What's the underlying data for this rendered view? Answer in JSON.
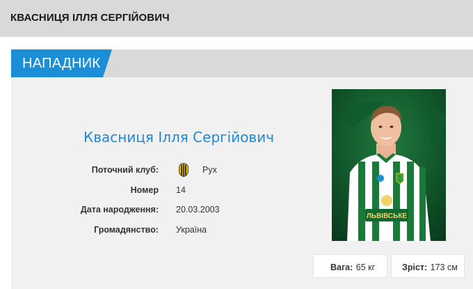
{
  "page": {
    "title": "КВАСНИЦЯ ІЛЛЯ СЕРГІЙОВИЧ"
  },
  "card": {
    "position": "НАПАДНИК",
    "player_name": "Квасниця Ілля Сергійович",
    "info": [
      {
        "label": "Поточний клуб:",
        "value": "Рух"
      },
      {
        "label": "Номер",
        "value": "14"
      },
      {
        "label": "Дата народження:",
        "value": "20.03.2003"
      },
      {
        "label": "Громадянство:",
        "value": "Україна"
      }
    ],
    "photo": {
      "sponsor_text": "ЛЬВІВСЬКЕ",
      "icon": "player-photo"
    },
    "stats": {
      "weight_label": "Вага:",
      "weight_value": "65 кг",
      "height_label": "Зріст:",
      "height_value": "173 см"
    },
    "colors": {
      "accent": "#1a8fd8",
      "name": "#1e8ad2",
      "header": "#d9d9d9",
      "card_bg": "#f1f1f1"
    }
  }
}
